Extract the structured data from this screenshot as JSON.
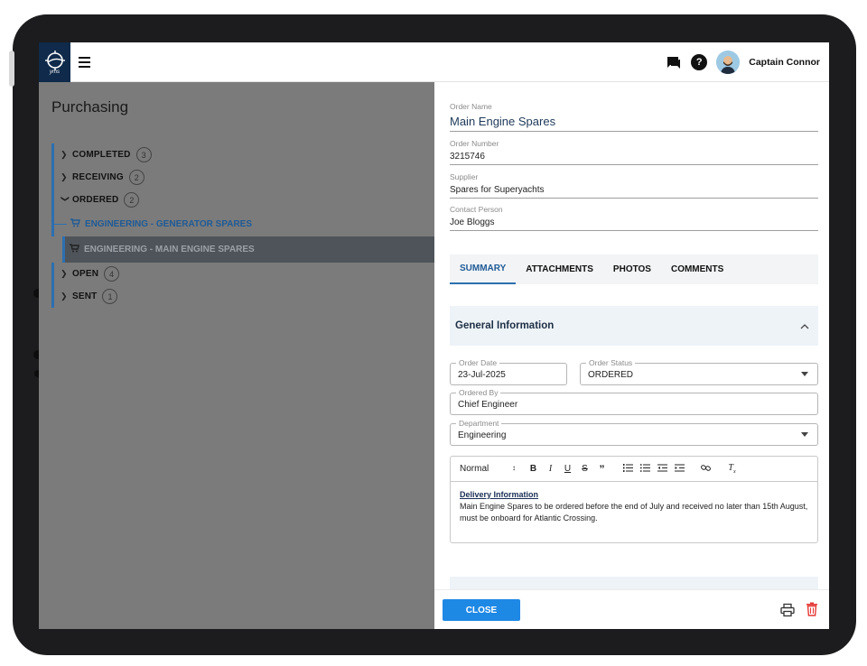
{
  "topbar": {
    "logo_text": "yms",
    "menu_icon": "hamburger-menu-icon",
    "user_name": "Captain Connor"
  },
  "purchasing": {
    "title": "Purchasing",
    "groups": [
      {
        "label": "COMPLETED",
        "count": "3",
        "expanded": false
      },
      {
        "label": "RECEIVING",
        "count": "2",
        "expanded": false
      },
      {
        "label": "ORDERED",
        "count": "2",
        "expanded": true
      },
      {
        "label": "OPEN",
        "count": "4",
        "expanded": false
      },
      {
        "label": "SENT",
        "count": "1",
        "expanded": false
      }
    ],
    "ordered_items": [
      {
        "label": "ENGINEERING - GENERATOR SPARES"
      },
      {
        "label": "ENGINEERING - MAIN ENGINE SPARES",
        "selected": true
      }
    ]
  },
  "order": {
    "name_label": "Order Name",
    "name": "Main Engine Spares",
    "number_label": "Order Number",
    "number": "3215746",
    "supplier_label": "Supplier",
    "supplier": "Spares for Superyachts",
    "contact_label": "Contact Person",
    "contact": "Joe Bloggs"
  },
  "tabs": [
    "SUMMARY",
    "ATTACHMENTS",
    "PHOTOS",
    "COMMENTS"
  ],
  "general": {
    "title": "General Information",
    "order_date_label": "Order Date",
    "order_date": "23-Jul-2025",
    "order_status_label": "Order Status",
    "order_status": "ORDERED",
    "ordered_by_label": "Ordered By",
    "ordered_by": "Chief Engineer",
    "department_label": "Department",
    "department": "Engineering"
  },
  "editor": {
    "format": "Normal",
    "content_title": "Delivery Information",
    "content_text": "Main Engine Spares to be ordered before the end of July and received no later than 15th August, must be onboard for Atlantic Crossing."
  },
  "footer": {
    "close_label": "CLOSE"
  },
  "colors": {
    "accent": "#1e88e5",
    "tree_accent": "#2d6fb0",
    "logo_bg": "#0f2a4a",
    "delete": "#e53935"
  }
}
